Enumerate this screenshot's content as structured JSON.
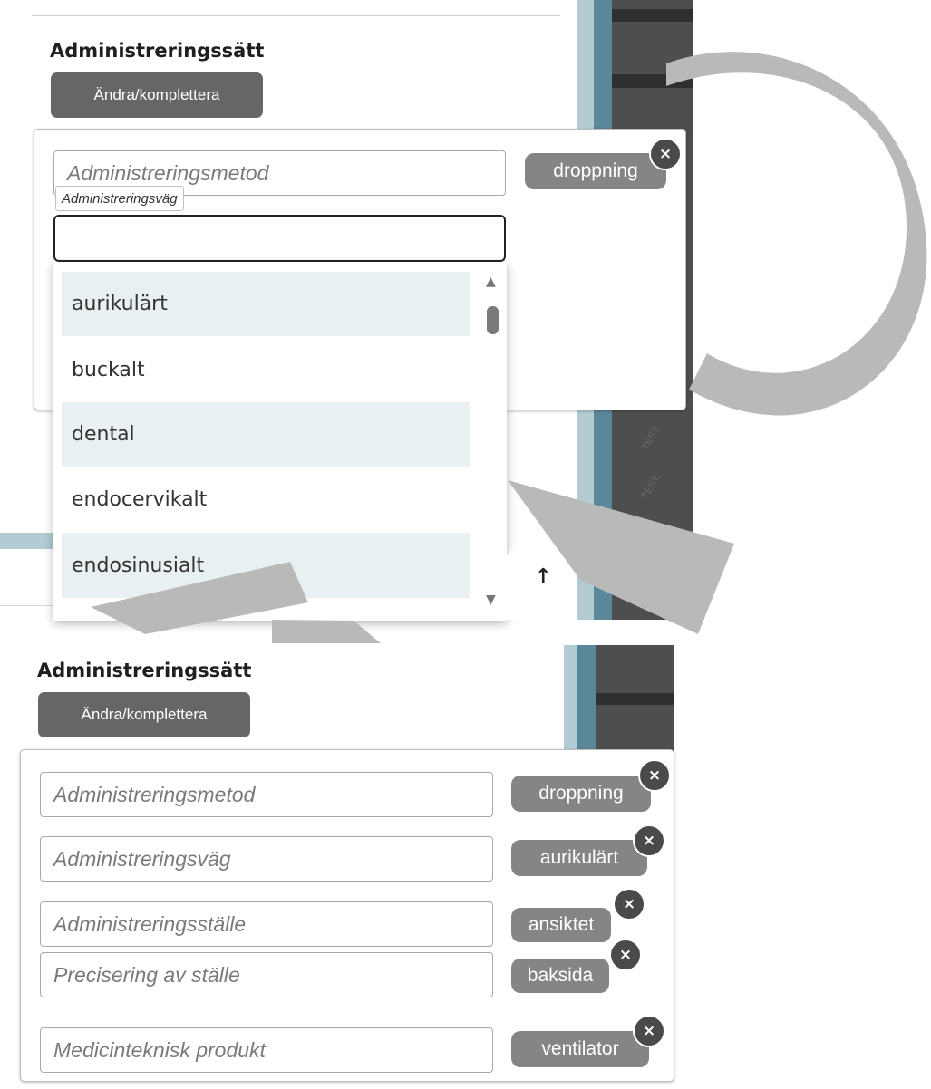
{
  "top": {
    "section_title": "Administreringssätt",
    "edit_button": "Ändra/komplettera",
    "fields": [
      {
        "placeholder": "Administreringsmetod",
        "tag": "droppning",
        "remove": "×"
      }
    ],
    "route_label": "Administreringsväg",
    "route_input_value": "",
    "dropdown_options": [
      "aurikulärt",
      "buckalt",
      "dental",
      "endocervikalt",
      "endosinusialt"
    ],
    "watermarks": [
      "TEST",
      "TEST",
      "TEST",
      "TEST",
      "TEST"
    ],
    "scroll_up_glyph": "▲",
    "scroll_down_glyph": "▼",
    "back_to_top_glyph": "↑"
  },
  "bottom": {
    "section_title": "Administreringssätt",
    "edit_button": "Ändra/komplettera",
    "fields": [
      {
        "placeholder": "Administreringsmetod",
        "tag": "droppning",
        "remove": "×"
      },
      {
        "placeholder": "Administreringsväg",
        "tag": "aurikulärt",
        "remove": "×"
      },
      {
        "placeholder": "Administreringsställe",
        "tag": "ansiktet",
        "remove": "×"
      },
      {
        "placeholder": "Precisering av ställe",
        "tag": "baksida",
        "remove": "×"
      },
      {
        "placeholder": "Medicinteknisk produkt",
        "tag": "ventilator",
        "remove": "×"
      }
    ]
  },
  "colors": {
    "dark_button": "#666666",
    "tag_bg": "#858585",
    "option_highlight": "#e8f0f2",
    "swoosh": "#b9b9b9"
  }
}
